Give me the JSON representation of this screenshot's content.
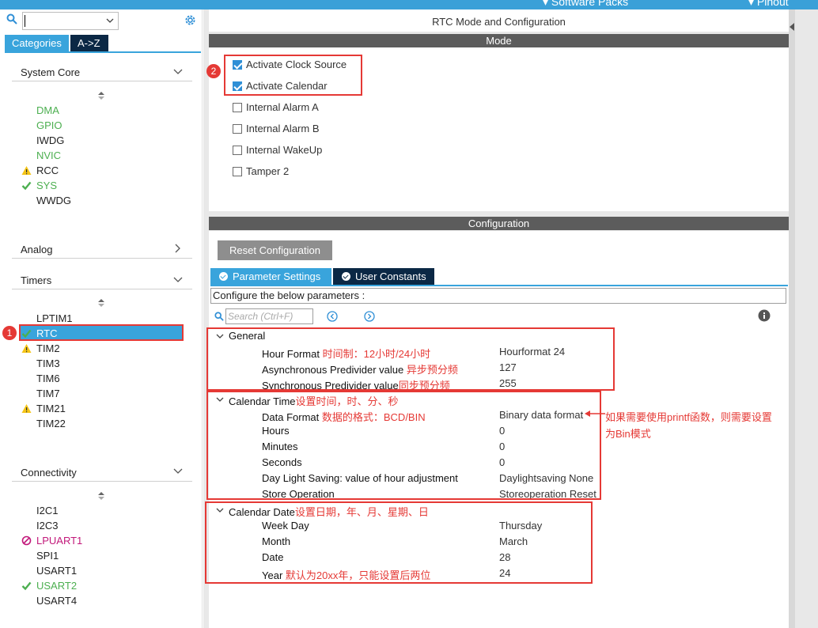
{
  "topbar": {
    "software_packs": "Software Packs",
    "pinout": "Pinout"
  },
  "left": {
    "search_value": "",
    "tabs": {
      "categories": "Categories",
      "az": "A->Z"
    },
    "system_core": {
      "title": "System Core",
      "items": [
        {
          "label": "DMA",
          "color": "green"
        },
        {
          "label": "GPIO",
          "color": "green"
        },
        {
          "label": "IWDG",
          "color": "dark"
        },
        {
          "label": "NVIC",
          "color": "green"
        },
        {
          "label": "RCC",
          "color": "dark",
          "status": "warning"
        },
        {
          "label": "SYS",
          "color": "green",
          "status": "check"
        },
        {
          "label": "WWDG",
          "color": "dark"
        }
      ]
    },
    "analog": {
      "title": "Analog"
    },
    "timers": {
      "title": "Timers",
      "items": [
        {
          "label": "LPTIM1",
          "color": "dark"
        },
        {
          "label": "RTC",
          "color": "selected",
          "status": "check"
        },
        {
          "label": "TIM2",
          "color": "dark",
          "status": "warning"
        },
        {
          "label": "TIM3",
          "color": "dark"
        },
        {
          "label": "TIM6",
          "color": "dark"
        },
        {
          "label": "TIM7",
          "color": "dark"
        },
        {
          "label": "TIM21",
          "color": "dark",
          "status": "warning"
        },
        {
          "label": "TIM22",
          "color": "dark"
        }
      ]
    },
    "connectivity": {
      "title": "Connectivity",
      "items": [
        {
          "label": "I2C1",
          "color": "dark"
        },
        {
          "label": "I2C3",
          "color": "dark"
        },
        {
          "label": "LPUART1",
          "color": "magenta",
          "status": "disabled"
        },
        {
          "label": "SPI1",
          "color": "dark"
        },
        {
          "label": "USART1",
          "color": "dark"
        },
        {
          "label": "USART2",
          "color": "green",
          "status": "check"
        },
        {
          "label": "USART4",
          "color": "dark"
        }
      ]
    }
  },
  "main": {
    "title": "RTC Mode and Configuration",
    "mode_bar": "Mode",
    "mode": [
      {
        "label": "Activate Clock Source",
        "checked": true
      },
      {
        "label": "Activate Calendar",
        "checked": true
      },
      {
        "label": "Internal Alarm A",
        "checked": false
      },
      {
        "label": "Internal Alarm B",
        "checked": false
      },
      {
        "label": "Internal WakeUp",
        "checked": false
      },
      {
        "label": "Tamper 2",
        "checked": false
      }
    ],
    "config_bar": "Configuration",
    "reset_button": "Reset Configuration",
    "tabs": {
      "params": "Parameter Settings",
      "user_constants": "User Constants"
    },
    "configure_label": "Configure the below parameters :",
    "search_placeholder": "Search (Ctrl+F)",
    "groups": {
      "general": {
        "title": "General",
        "rows": [
          {
            "name": "Hour Format",
            "note": "时间制：12小时/24小时",
            "value": "Hourformat 24"
          },
          {
            "name": "Asynchronous Predivider value",
            "note": "异步预分频",
            "value": "127"
          },
          {
            "name": "Synchronous Predivider value",
            "note": "同步预分频",
            "value": "255"
          }
        ]
      },
      "calendar_time": {
        "title": "Calendar Time",
        "note": "设置时间，时、分、秒",
        "rows": [
          {
            "name": "Data Format",
            "note": "数据的格式：BCD/BIN",
            "value": "Binary data format"
          },
          {
            "name": "Hours",
            "note": "",
            "value": "0"
          },
          {
            "name": "Minutes",
            "note": "",
            "value": "0"
          },
          {
            "name": "Seconds",
            "note": "",
            "value": "0"
          },
          {
            "name": "Day Light Saving: value of hour adjustment",
            "note": "",
            "value": "Daylightsaving None"
          },
          {
            "name": "Store Operation",
            "note": "",
            "value": "Storeoperation Reset"
          }
        ]
      },
      "calendar_date": {
        "title": "Calendar Date",
        "note": "设置日期，年、月、星期、日",
        "rows": [
          {
            "name": "Week Day",
            "note": "",
            "value": "Thursday"
          },
          {
            "name": "Month",
            "note": "",
            "value": "March"
          },
          {
            "name": "Date",
            "note": "",
            "value": "28"
          },
          {
            "name": "Year",
            "note": "默认为20xx年，只能设置后两位",
            "value": "24"
          }
        ]
      }
    },
    "side_note_line1": "如果需要使用printf函数，则需要设置",
    "side_note_line2": "为Bin模式",
    "badges": {
      "one": "1",
      "two": "2"
    }
  },
  "colors": {
    "accent": "#39a4dc",
    "dark_tab": "#0b2845",
    "annotation": "#e53935",
    "ok": "#4caf50",
    "warn": "#f5c518"
  }
}
